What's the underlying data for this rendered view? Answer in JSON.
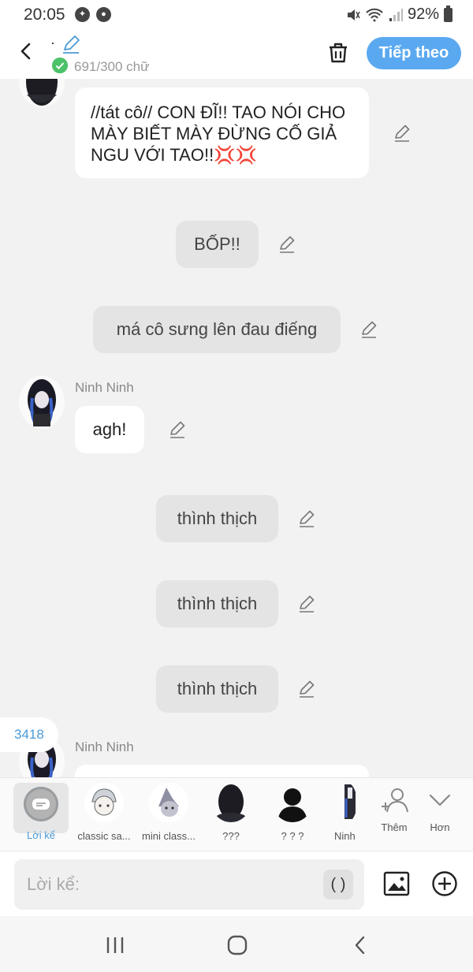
{
  "status_bar": {
    "time": "20:05",
    "battery": "92%"
  },
  "header": {
    "title": "·",
    "word_count": "691/300 chữ",
    "next_label": "Tiếp theo"
  },
  "messages": [
    {
      "type": "character",
      "text": "//tát cô// CON ĐĨ!! TAO NÓI CHO MÀY BIẾT MÀY ĐỪNG CỐ GIẢ NGU VỚI TAO!!💢💢"
    },
    {
      "type": "narration",
      "text": "BỐP!!"
    },
    {
      "type": "narration",
      "text": "má cô sưng lên đau điếng"
    },
    {
      "type": "character",
      "name": "Ninh Ninh",
      "text": "agh!"
    },
    {
      "type": "narration",
      "text": "thình thịch"
    },
    {
      "type": "narration",
      "text": "thình thịch"
    },
    {
      "type": "narration",
      "text": "thình thịch"
    },
    {
      "type": "character",
      "name": "Ninh Ninh",
      "text": ""
    }
  ],
  "count_badge": "3418",
  "characters": [
    {
      "label": "Lời kể",
      "active": true
    },
    {
      "label": "classic sa..."
    },
    {
      "label": "mini class..."
    },
    {
      "label": "???"
    },
    {
      "label": "? ? ?"
    },
    {
      "label": "Ninh"
    }
  ],
  "char_actions": {
    "add_label": "Thêm",
    "more_label": "Hơn"
  },
  "input": {
    "placeholder": "Lời kể:",
    "paren_label": "( )"
  },
  "colors": {
    "accent": "#5aa9f0",
    "check": "#4cc269",
    "background": "#f2f2f2"
  }
}
